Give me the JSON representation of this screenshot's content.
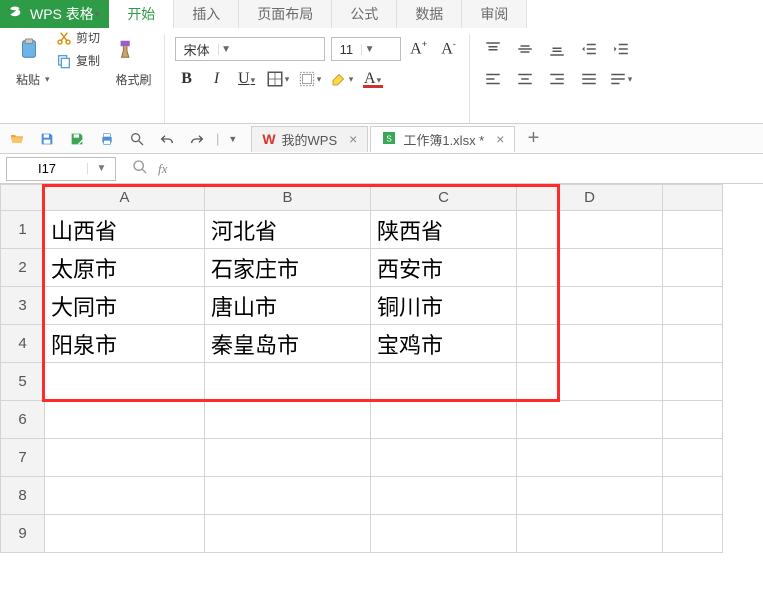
{
  "app": {
    "name": "WPS 表格"
  },
  "ribbon_tabs": [
    "开始",
    "插入",
    "页面布局",
    "公式",
    "数据",
    "审阅"
  ],
  "active_ribbon_tab": 0,
  "clipboard": {
    "paste": "粘贴",
    "cut": "剪切",
    "copy": "复制",
    "format_painter": "格式刷"
  },
  "font": {
    "family": "宋体",
    "size": "11"
  },
  "doc_tabs": [
    {
      "label": "我的WPS",
      "kind": "wps",
      "active": false
    },
    {
      "label": "工作簿1.xlsx *",
      "kind": "xlsx",
      "active": true
    }
  ],
  "namebox": {
    "value": "I17"
  },
  "sheet": {
    "columns": [
      "A",
      "B",
      "C",
      "D"
    ],
    "row_numbers": [
      1,
      2,
      3,
      4,
      5,
      6,
      7,
      8,
      9
    ],
    "cells": {
      "A1": "山西省",
      "B1": "河北省",
      "C1": "陕西省",
      "A2": "太原市",
      "B2": "石家庄市",
      "C2": "西安市",
      "A3": "大同市",
      "B3": "唐山市",
      "C3": "铜川市",
      "A4": "阳泉市",
      "B4": "秦皇岛市",
      "C4": "宝鸡市"
    }
  }
}
